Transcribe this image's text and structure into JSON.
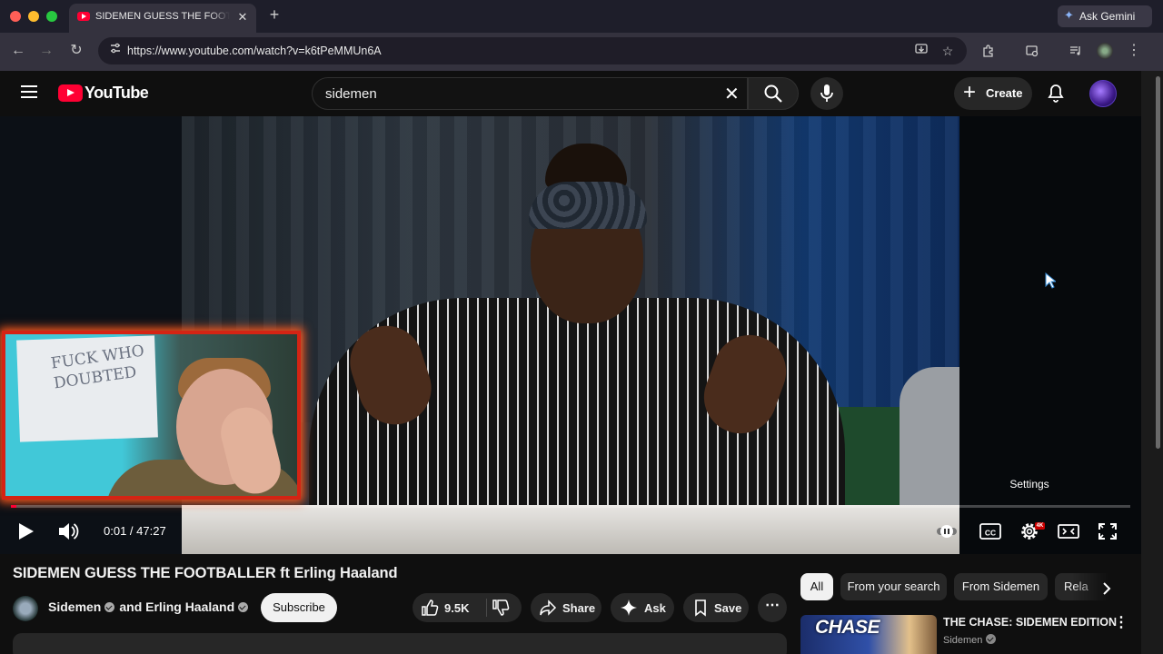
{
  "browser": {
    "tab": {
      "title": "SIDEMEN GUESS THE FOOTBALLER ft Erling Haaland"
    },
    "gemini_label": "Ask Gemini",
    "url": "https://www.youtube.com/watch?v=k6tPeMMUn6A"
  },
  "youtube": {
    "wordmark": "YouTube",
    "search": {
      "query": "sidemen"
    },
    "create_label": "Create"
  },
  "player": {
    "time": "0:01 / 47:27",
    "progress_fraction": 0.00035,
    "tooltip": "Settings",
    "quality_badge": "4K",
    "facecam_board_text": "FUCK WHO DOUBTED"
  },
  "video": {
    "title": "SIDEMEN GUESS THE FOOTBALLER ft Erling Haaland",
    "channel": "Sidemen",
    "channel_joiner": "and",
    "collaborator": "Erling Haaland",
    "subscribe_label": "Subscribe",
    "likes": "9.5K",
    "share_label": "Share",
    "ask_label": "Ask",
    "save_label": "Save"
  },
  "filters": [
    "All",
    "From your search",
    "From Sidemen",
    "Rela"
  ],
  "recommendation": {
    "thumb_text": "CHASE",
    "title": "THE CHASE: SIDEMEN EDITION",
    "channel": "Sidemen"
  },
  "colors": {
    "brand_red": "#ff0033",
    "background": "#0f0f0f",
    "facecam_border": "#d42414"
  }
}
